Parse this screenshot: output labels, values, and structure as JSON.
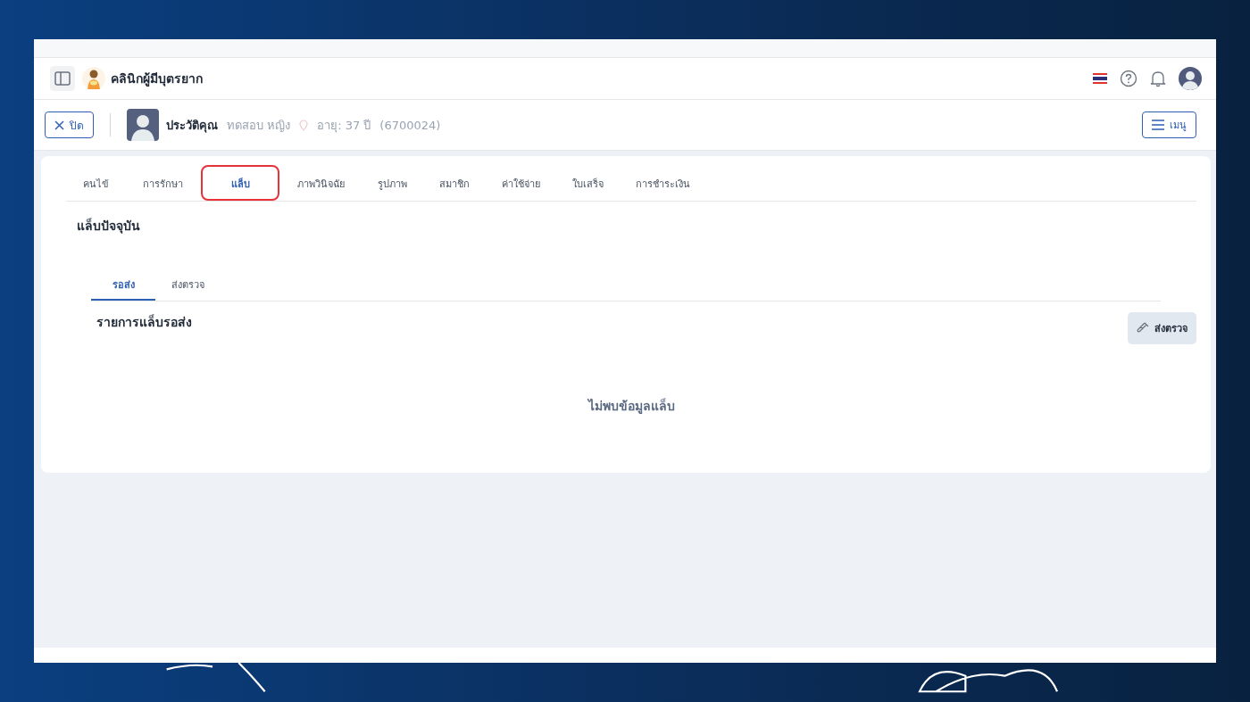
{
  "header": {
    "clinic_name": "คลินิกผู้มีบุตรยาก"
  },
  "patient_bar": {
    "close_button": "ปิด",
    "title": "ประวัติคุณ",
    "patient_name": "ทดสอบ หญิง",
    "age": "อายุ: 37 ปี",
    "patient_id": "(6700024)",
    "menu_button": "เมนู"
  },
  "tabs": [
    {
      "label": "คนไข้",
      "selected": false,
      "highlighted": false
    },
    {
      "label": "การรักษา",
      "selected": false,
      "highlighted": false
    },
    {
      "label": "แล็บ",
      "selected": true,
      "highlighted": true
    },
    {
      "label": "ภาพวินิจฉัย",
      "selected": false,
      "highlighted": false
    },
    {
      "label": "รูปภาพ",
      "selected": false,
      "highlighted": false
    },
    {
      "label": "สมาชิก",
      "selected": false,
      "highlighted": false
    },
    {
      "label": "ค่าใช้จ่าย",
      "selected": false,
      "highlighted": false
    },
    {
      "label": "ใบเสร็จ",
      "selected": false,
      "highlighted": false
    },
    {
      "label": "การชำระเงิน",
      "selected": false,
      "highlighted": false
    }
  ],
  "section_title": "แล็บปัจจุบัน",
  "sub_tabs": [
    {
      "label": "รอส่ง",
      "selected": true
    },
    {
      "label": "ส่งตรวจ",
      "selected": false
    }
  ],
  "list_title": "รายการแล็บรอส่ง",
  "send_button": "ส่งตรวจ",
  "empty_message": "ไม่พบข้อมูลแล็บ"
}
